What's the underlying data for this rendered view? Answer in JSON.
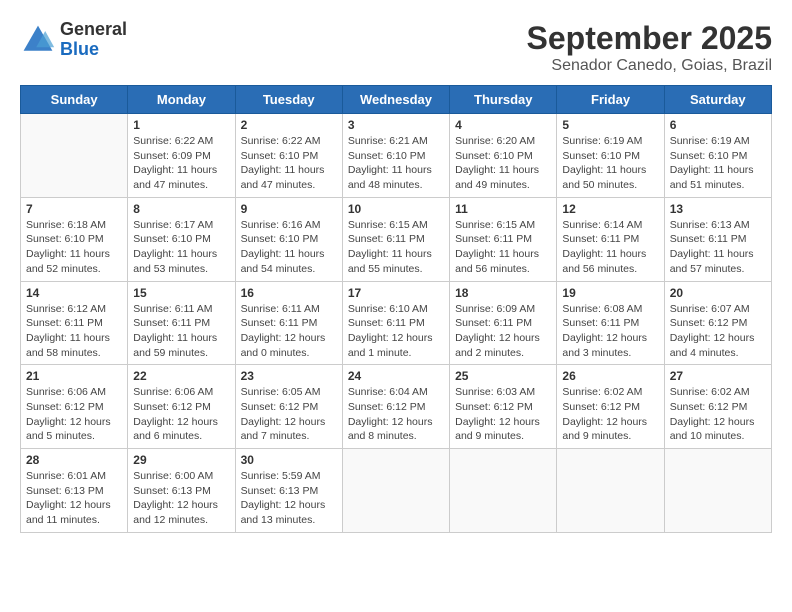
{
  "header": {
    "logo_general": "General",
    "logo_blue": "Blue",
    "month_title": "September 2025",
    "location": "Senador Canedo, Goias, Brazil"
  },
  "days_of_week": [
    "Sunday",
    "Monday",
    "Tuesday",
    "Wednesday",
    "Thursday",
    "Friday",
    "Saturday"
  ],
  "weeks": [
    [
      {
        "day": "",
        "info": ""
      },
      {
        "day": "1",
        "info": "Sunrise: 6:22 AM\nSunset: 6:09 PM\nDaylight: 11 hours\nand 47 minutes."
      },
      {
        "day": "2",
        "info": "Sunrise: 6:22 AM\nSunset: 6:10 PM\nDaylight: 11 hours\nand 47 minutes."
      },
      {
        "day": "3",
        "info": "Sunrise: 6:21 AM\nSunset: 6:10 PM\nDaylight: 11 hours\nand 48 minutes."
      },
      {
        "day": "4",
        "info": "Sunrise: 6:20 AM\nSunset: 6:10 PM\nDaylight: 11 hours\nand 49 minutes."
      },
      {
        "day": "5",
        "info": "Sunrise: 6:19 AM\nSunset: 6:10 PM\nDaylight: 11 hours\nand 50 minutes."
      },
      {
        "day": "6",
        "info": "Sunrise: 6:19 AM\nSunset: 6:10 PM\nDaylight: 11 hours\nand 51 minutes."
      }
    ],
    [
      {
        "day": "7",
        "info": "Sunrise: 6:18 AM\nSunset: 6:10 PM\nDaylight: 11 hours\nand 52 minutes."
      },
      {
        "day": "8",
        "info": "Sunrise: 6:17 AM\nSunset: 6:10 PM\nDaylight: 11 hours\nand 53 minutes."
      },
      {
        "day": "9",
        "info": "Sunrise: 6:16 AM\nSunset: 6:10 PM\nDaylight: 11 hours\nand 54 minutes."
      },
      {
        "day": "10",
        "info": "Sunrise: 6:15 AM\nSunset: 6:11 PM\nDaylight: 11 hours\nand 55 minutes."
      },
      {
        "day": "11",
        "info": "Sunrise: 6:15 AM\nSunset: 6:11 PM\nDaylight: 11 hours\nand 56 minutes."
      },
      {
        "day": "12",
        "info": "Sunrise: 6:14 AM\nSunset: 6:11 PM\nDaylight: 11 hours\nand 56 minutes."
      },
      {
        "day": "13",
        "info": "Sunrise: 6:13 AM\nSunset: 6:11 PM\nDaylight: 11 hours\nand 57 minutes."
      }
    ],
    [
      {
        "day": "14",
        "info": "Sunrise: 6:12 AM\nSunset: 6:11 PM\nDaylight: 11 hours\nand 58 minutes."
      },
      {
        "day": "15",
        "info": "Sunrise: 6:11 AM\nSunset: 6:11 PM\nDaylight: 11 hours\nand 59 minutes."
      },
      {
        "day": "16",
        "info": "Sunrise: 6:11 AM\nSunset: 6:11 PM\nDaylight: 12 hours\nand 0 minutes."
      },
      {
        "day": "17",
        "info": "Sunrise: 6:10 AM\nSunset: 6:11 PM\nDaylight: 12 hours\nand 1 minute."
      },
      {
        "day": "18",
        "info": "Sunrise: 6:09 AM\nSunset: 6:11 PM\nDaylight: 12 hours\nand 2 minutes."
      },
      {
        "day": "19",
        "info": "Sunrise: 6:08 AM\nSunset: 6:11 PM\nDaylight: 12 hours\nand 3 minutes."
      },
      {
        "day": "20",
        "info": "Sunrise: 6:07 AM\nSunset: 6:12 PM\nDaylight: 12 hours\nand 4 minutes."
      }
    ],
    [
      {
        "day": "21",
        "info": "Sunrise: 6:06 AM\nSunset: 6:12 PM\nDaylight: 12 hours\nand 5 minutes."
      },
      {
        "day": "22",
        "info": "Sunrise: 6:06 AM\nSunset: 6:12 PM\nDaylight: 12 hours\nand 6 minutes."
      },
      {
        "day": "23",
        "info": "Sunrise: 6:05 AM\nSunset: 6:12 PM\nDaylight: 12 hours\nand 7 minutes."
      },
      {
        "day": "24",
        "info": "Sunrise: 6:04 AM\nSunset: 6:12 PM\nDaylight: 12 hours\nand 8 minutes."
      },
      {
        "day": "25",
        "info": "Sunrise: 6:03 AM\nSunset: 6:12 PM\nDaylight: 12 hours\nand 9 minutes."
      },
      {
        "day": "26",
        "info": "Sunrise: 6:02 AM\nSunset: 6:12 PM\nDaylight: 12 hours\nand 9 minutes."
      },
      {
        "day": "27",
        "info": "Sunrise: 6:02 AM\nSunset: 6:12 PM\nDaylight: 12 hours\nand 10 minutes."
      }
    ],
    [
      {
        "day": "28",
        "info": "Sunrise: 6:01 AM\nSunset: 6:13 PM\nDaylight: 12 hours\nand 11 minutes."
      },
      {
        "day": "29",
        "info": "Sunrise: 6:00 AM\nSunset: 6:13 PM\nDaylight: 12 hours\nand 12 minutes."
      },
      {
        "day": "30",
        "info": "Sunrise: 5:59 AM\nSunset: 6:13 PM\nDaylight: 12 hours\nand 13 minutes."
      },
      {
        "day": "",
        "info": ""
      },
      {
        "day": "",
        "info": ""
      },
      {
        "day": "",
        "info": ""
      },
      {
        "day": "",
        "info": ""
      }
    ]
  ]
}
